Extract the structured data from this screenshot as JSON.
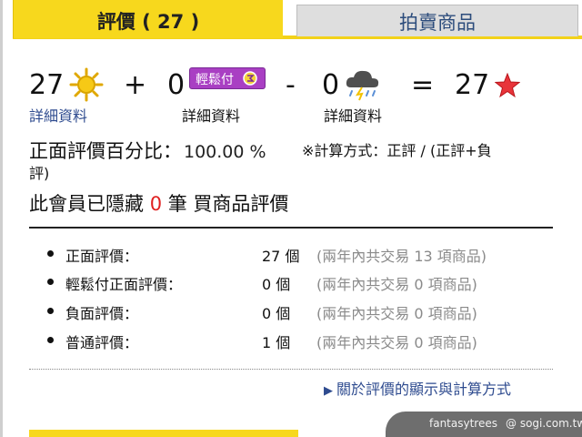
{
  "tabs": {
    "active_label": "評價 ( 27 )",
    "inactive_label": "拍賣商品"
  },
  "summary": {
    "positive_count": "27",
    "easypay_count": "0",
    "easypay_badge": "輕鬆付",
    "negative_count": "0",
    "total": "27",
    "plus": "+",
    "minus": "-",
    "equals": "=",
    "detail_link": "詳細資料",
    "detail_label_1": "詳細資料",
    "detail_label_2": "詳細資料"
  },
  "percentage": {
    "label": "正面評價百分比：",
    "value": "100.00 %",
    "formula_line1": "※計算方式：正評 / (正評+負",
    "formula_line2": "評)"
  },
  "hidden_notice": {
    "prefix": "此會員已隱藏",
    "count": "0",
    "suffix": "筆 買商品評價"
  },
  "breakdown": [
    {
      "label": "正面評價：",
      "count": "27 個",
      "note": "(兩年內共交易 13 項商品)"
    },
    {
      "label": "輕鬆付正面評價：",
      "count": "0 個",
      "note": "(兩年內共交易 0 項商品)"
    },
    {
      "label": "負面評價：",
      "count": "0 個",
      "note": "(兩年內共交易 0 項商品)"
    },
    {
      "label": "普通評價：",
      "count": "1 個",
      "note": "(兩年內共交易 0 項商品)"
    }
  ],
  "about_link": "關於評價的顯示與計算方式",
  "watermark": {
    "user": "fantasytrees",
    "site": "@ sogi.com.tw"
  },
  "icons": {
    "sun": "sun-icon",
    "star": "star-icon",
    "storm": "storm-cloud-icon",
    "triangle": "triangle-right-icon"
  },
  "colors": {
    "tab_active": "#f7d81d",
    "tab_inactive": "#dedede",
    "link": "#2e4b8f",
    "badge": "#a93fc3",
    "hidden_count": "#e02020",
    "note": "#8a8a8a"
  }
}
